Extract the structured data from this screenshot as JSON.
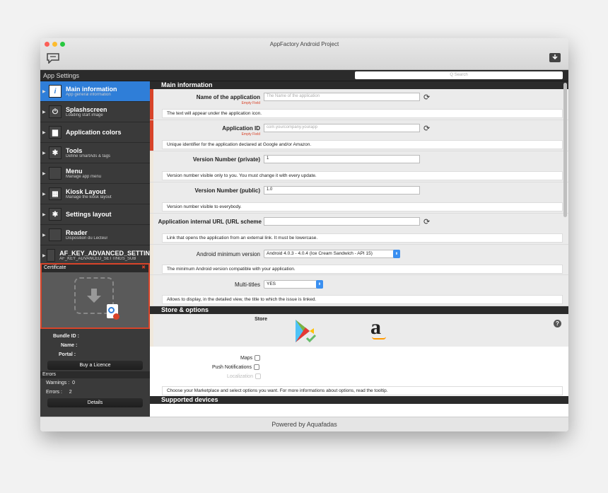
{
  "window": {
    "title": "AppFactory Android Project",
    "footer": "Powered by Aquafadas"
  },
  "colors": {
    "accent": "#2f7ed8",
    "error": "#d8442a",
    "dark": "#2b2b2b"
  },
  "sidebar": {
    "header": "App Settings",
    "items": [
      {
        "title": "Main information",
        "sub": "App general information",
        "icon": "info-icon",
        "glyph": "i"
      },
      {
        "title": "Splashscreen",
        "sub": "Loading start image",
        "icon": "power-icon",
        "glyph": "⏻"
      },
      {
        "title": "Application colors",
        "sub": "",
        "icon": "palette-icon",
        "glyph": "▆"
      },
      {
        "title": "Tools",
        "sub": "Define smartAds & tags",
        "icon": "tools-icon",
        "glyph": "✱"
      },
      {
        "title": "Menu",
        "sub": "Manage app menu",
        "icon": "menu-icon",
        "glyph": ""
      },
      {
        "title": "Kiosk Layout",
        "sub": "Manage the kiosk layout",
        "icon": "grid-icon",
        "glyph": "▦"
      },
      {
        "title": "Settings layout",
        "sub": "",
        "icon": "tools-icon",
        "glyph": "✱"
      },
      {
        "title": "Reader",
        "sub": "Disposition du Lecteur",
        "icon": "reader-icon",
        "glyph": ""
      },
      {
        "title": "AF_KEY_ADVANCED_SETTIN",
        "sub": "AF_KEY_ADVANCED_SETTINGS_SUB",
        "icon": "settings-icon",
        "glyph": ""
      }
    ],
    "certificate_label": "Certificate",
    "bundle_label": "Bundle ID :",
    "name_label": "Name :",
    "portal_label": "Portal :",
    "buy_button": "Buy a Licence",
    "errors_header": "Errors",
    "warnings_label": "Warnings :",
    "warnings_value": "0",
    "errors_label": "Errors :",
    "errors_value": "2",
    "details_button": "Details"
  },
  "main": {
    "search_placeholder": "Q  Search",
    "section_main": "Main information",
    "empty_field": "Empty Field",
    "fields": {
      "app_name": {
        "label": "Name of the application",
        "placeholder": "The Name of the application",
        "help": "The text will appear under the application icon."
      },
      "app_id": {
        "label": "Application ID",
        "placeholder": "com.yourcompany.yourapp",
        "help": "Unique identifier for the application declared at Google and/or Amazon."
      },
      "version_private": {
        "label": "Version Number (private)",
        "value": "1",
        "help": "Version number visible only to you. You must change it with every update."
      },
      "version_public": {
        "label": "Version Number (public)",
        "value": "1.0",
        "help": "Version number visible to everybody."
      },
      "url_scheme": {
        "label": "Application internal URL (URL scheme",
        "value": "",
        "help": "Link that opens the application from an external link. It must be lowercase."
      },
      "android_min": {
        "label": "Android minimum version",
        "value": "Android 4.0.3 - 4.0.4 (Ice Cream Sandwich - API 15)",
        "help": "The minimum Android version compatible with your application."
      },
      "multi_titles": {
        "label": "Multi-titles",
        "value": "YES",
        "help": "Allows to display, in the detailed view, the title to which the issue is linked."
      }
    },
    "section_store": "Store & options",
    "store_label": "Store",
    "options": {
      "maps": "Maps",
      "push": "Push Notifications",
      "localization": "Localization"
    },
    "store_help": "Choose your Marketplace and select options you want. For more informations about options, read the tooltip.",
    "section_devices": "Supported devices"
  }
}
